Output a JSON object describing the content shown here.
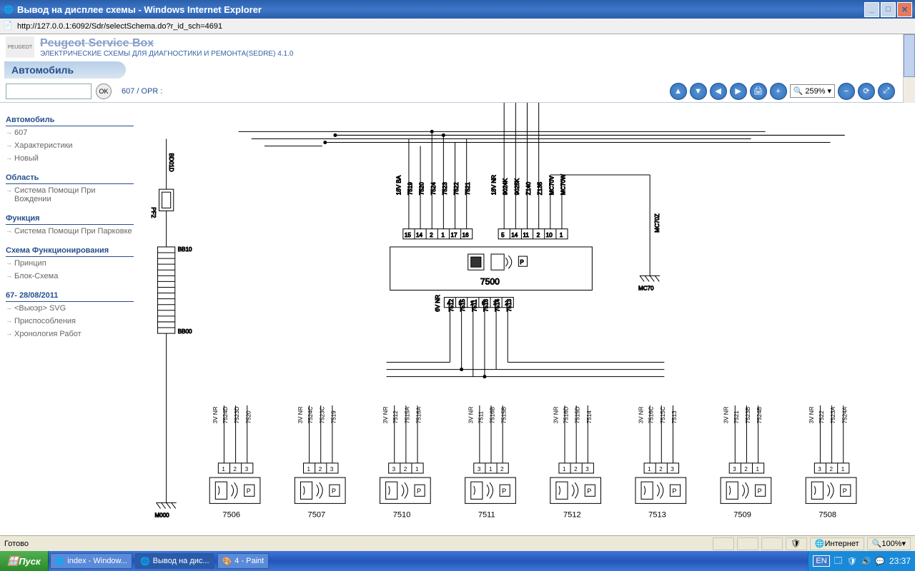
{
  "window": {
    "title": "Вывод на дисплее схемы - Windows Internet Explorer",
    "url": "http://127.0.0.1:6092/Sdr/selectSchema.do?r_id_sch=4691"
  },
  "brand": {
    "logo_text": "PEUGEOT",
    "title": "Peugeot Service Box",
    "subtitle": "ЭЛЕКТРИЧЕСКИЕ СХЕМЫ ДЛЯ ДИАГНОСТИКИ И РЕМОНТА(SEDRE) 4.1.0"
  },
  "section_header": "Автомобиль",
  "toolbar": {
    "ok": "OK",
    "breadcrumb": "607  /  OPR :",
    "zoom": "259%",
    "zoom_icon": "🔍"
  },
  "sidebar": {
    "g1": {
      "hdr": "Автомобиль",
      "l1": "607",
      "l2": "Характеристики",
      "l3": "Новый"
    },
    "g2": {
      "hdr": "Область",
      "l1": "Система Помощи При Вождении"
    },
    "g3": {
      "hdr": "Функция",
      "l1": "Система Помощи При Парковке"
    },
    "g4": {
      "hdr": "Схема Функционирования",
      "l1": "Принцип",
      "l2": "Блок-Схема"
    },
    "g5": {
      "hdr": "67- 28/08/2011",
      "l1": "<Вьюэр> SVG",
      "l2": "Приспособления",
      "l3": "Хронология Работ"
    }
  },
  "diagram": {
    "main_unit": "7500",
    "ground_left": "M000",
    "ground_right": "MC70",
    "fuse": "PF2",
    "bb_top": "BB10",
    "bb_bot": "BB00",
    "bd": "BD01D",
    "mc70z": "MC70Z",
    "top_conn": {
      "v18ba": "18V  BA",
      "v18nr": "18V  NR",
      "w7519": "7519",
      "w7520": "7520",
      "w7524": "7524",
      "w7523": "7523",
      "w7522": "7522",
      "w7521": "7521",
      "w9024k": "9024K",
      "w9025k": "9025K",
      "wZ140": "Z140",
      "wZ135": "Z135",
      "wMC70V": "MC70V",
      "wMC70W": "MC70W",
      "p15": "15",
      "p14": "14",
      "p2": "2",
      "p1": "1",
      "p17": "17",
      "p16": "16",
      "p5": "5",
      "p14b": "14",
      "p11": "11",
      "p2b": "2",
      "p10": "10",
      "p1b": "1"
    },
    "bot_conn": {
      "v6nr": "6V  NR",
      "w7512": "7512",
      "w7515": "7515",
      "w7511": "7511",
      "w7516": "7516",
      "w7514": "7514",
      "w7513": "7513",
      "p4": "4",
      "p5": "5",
      "p1": "1",
      "p6": "6",
      "p3": "3",
      "p2": "2"
    },
    "sensors": {
      "s7506": {
        "id": "7506",
        "v": "3V  NR",
        "w1": "7524D",
        "w2": "7523D",
        "w3": "7520",
        "p1": "1",
        "p2": "2",
        "p3": "3"
      },
      "s7507": {
        "id": "7507",
        "v": "3V  NR",
        "w1": "7524C",
        "w2": "7523C",
        "w3": "7519",
        "p1": "1",
        "p2": "2",
        "p3": "3"
      },
      "s7510": {
        "id": "7510",
        "v": "3V  NR",
        "w1": "7512",
        "w2": "7515A",
        "w3": "7516A",
        "p1": "3",
        "p2": "2",
        "p3": "1"
      },
      "s7511": {
        "id": "7511",
        "v": "3V  NR",
        "w1": "7511",
        "w2": "7516B",
        "w3": "7515B",
        "p1": "3",
        "p2": "1",
        "p3": "2"
      },
      "s7512": {
        "id": "7512",
        "v": "3V  NR",
        "w1": "7516D",
        "w2": "7515D",
        "w3": "7514",
        "p1": "1",
        "p2": "2",
        "p3": "3"
      },
      "s7513": {
        "id": "7513",
        "v": "3V  NR",
        "w1": "7516C",
        "w2": "7515C",
        "w3": "7513",
        "p1": "1",
        "p2": "2",
        "p3": "3"
      },
      "s7509": {
        "id": "7509",
        "v": "3V  NR",
        "w1": "7521",
        "w2": "7523B",
        "w3": "7524B",
        "p1": "3",
        "p2": "2",
        "p3": "1"
      },
      "s7508": {
        "id": "7508",
        "v": "3V  NR",
        "w1": "7522",
        "w2": "7523A",
        "w3": "7524A",
        "p1": "3",
        "p2": "2",
        "p3": "1"
      }
    }
  },
  "status": {
    "ready": "Готово",
    "internet": "Интернет",
    "zoom": "100%"
  },
  "taskbar": {
    "start": "Пуск",
    "t1": "index - Window...",
    "t2": "Вывод на дис...",
    "t3": "4 - Paint",
    "lang": "EN",
    "clock": "23:37"
  }
}
